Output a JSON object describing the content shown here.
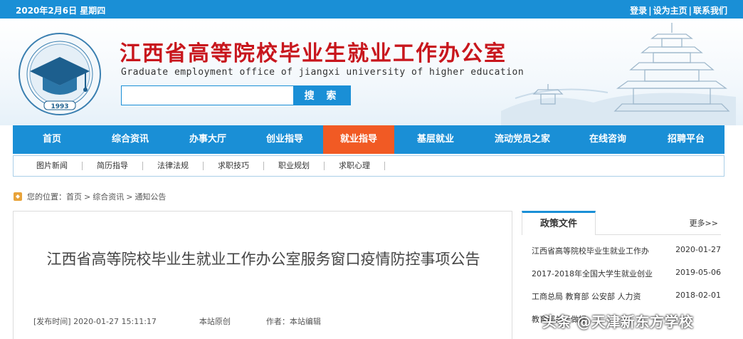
{
  "topbar": {
    "date": "2020年2月6日 星期四",
    "login": "登录",
    "set_home": "设为主页",
    "contact": "联系我们",
    "separator": "|"
  },
  "header": {
    "title_cn": "江西省高等院校毕业生就业工作办公室",
    "title_en": "Graduate employment office of jiangxi university of higher education",
    "logo_year": "1993",
    "search_placeholder": "",
    "search_button": "搜 索"
  },
  "nav": {
    "items": [
      {
        "label": "首页",
        "active": false
      },
      {
        "label": "综合资讯",
        "active": false
      },
      {
        "label": "办事大厅",
        "active": false
      },
      {
        "label": "创业指导",
        "active": false
      },
      {
        "label": "就业指导",
        "active": true
      },
      {
        "label": "基层就业",
        "active": false
      },
      {
        "label": "流动党员之家",
        "active": false
      },
      {
        "label": "在线咨询",
        "active": false
      },
      {
        "label": "招聘平台",
        "active": false
      }
    ]
  },
  "subnav": {
    "items": [
      "图片新闻",
      "简历指导",
      "法律法规",
      "求职技巧",
      "职业规划",
      "求职心理"
    ]
  },
  "breadcrumb": {
    "prefix": "您的位置：",
    "items": [
      "首页",
      "综合资讯",
      "通知公告"
    ],
    "separator": ">"
  },
  "article": {
    "title": "江西省高等院校毕业生就业工作办公室服务窗口疫情防控事项公告",
    "publish_time": "[发布时间] 2020-01-27 15:11:17",
    "source": "本站原创",
    "author": "作者：本站编辑"
  },
  "sidebar": {
    "tab": "政策文件",
    "more": "更多>>",
    "items": [
      {
        "title": "江西省高等院校毕业生就业工作办",
        "date": "2020-01-27"
      },
      {
        "title": "2017-2018年全国大学生就业创业",
        "date": "2019-05-06"
      },
      {
        "title": "工商总局 教育部 公安部 人力资",
        "date": "2018-02-01"
      },
      {
        "title": "教育部关于做好",
        "date": ""
      }
    ]
  },
  "watermark": "头条 @天津新东方学校",
  "colors": {
    "primary": "#1a8fd6",
    "active": "#f15a24",
    "title_red": "#c8161d"
  }
}
